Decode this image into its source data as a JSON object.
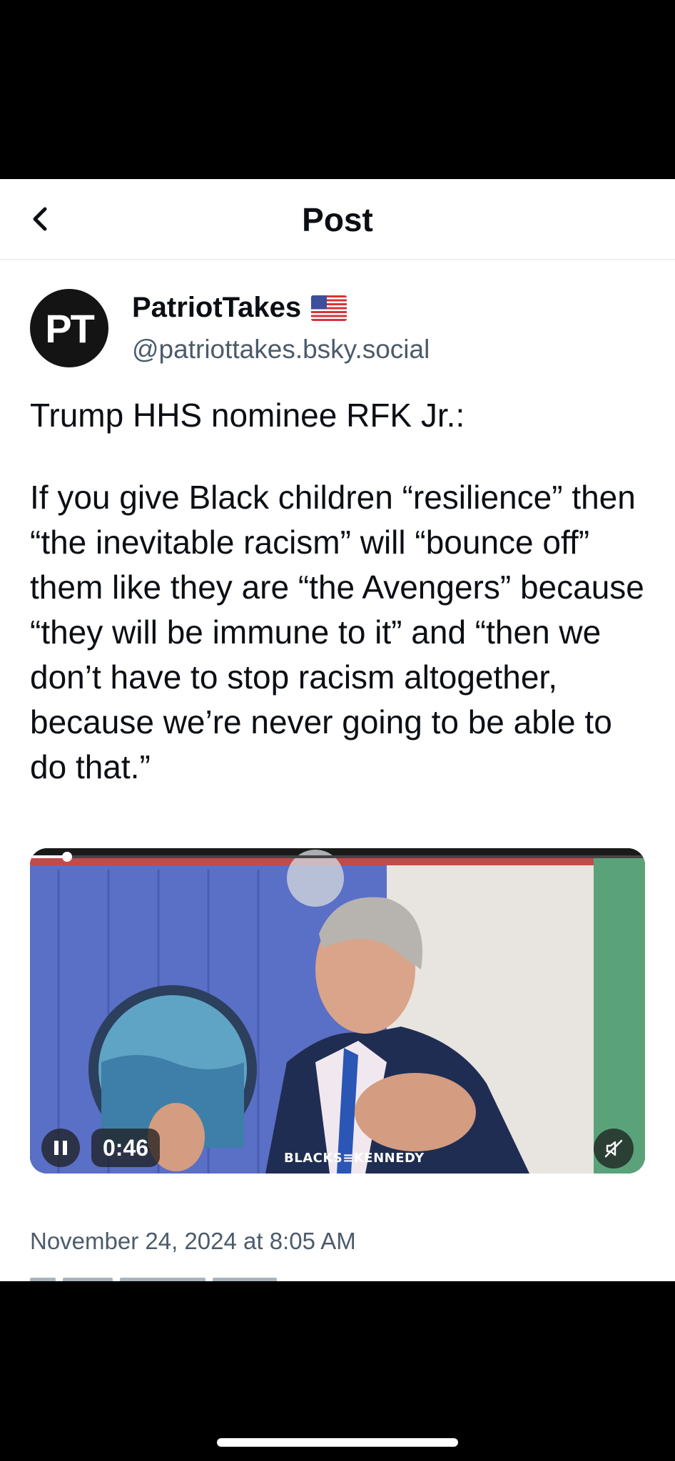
{
  "header": {
    "title": "Post",
    "back_icon": "chevron-left-icon"
  },
  "author": {
    "avatar_text": "PT",
    "display_name": "PatriotTakes",
    "flag_icon": "us-flag-icon",
    "handle": "@patriottakes.bsky.social"
  },
  "post": {
    "text_lines": [
      "Trump HHS nominee RFK Jr.:",
      "If you give Black children “resilience” then “the inevitable racism” will “bounce off” them like they are “the Avengers” because “they will be immune to it” and “then we don’t have to stop racism altogether, because we’re never going to be able to do that.”"
    ],
    "timestamp": "November 24, 2024 at 8:05 AM"
  },
  "video": {
    "time_remaining": "0:46",
    "watermark": "BLACKS≡KENNEDY",
    "pause_icon": "pause-icon",
    "mute_icon": "muted-speaker-icon",
    "progress": 0.02
  },
  "colors": {
    "text_primary": "#0b0f14",
    "text_secondary": "#4c5b6b",
    "divider": "#e3e6ea"
  }
}
